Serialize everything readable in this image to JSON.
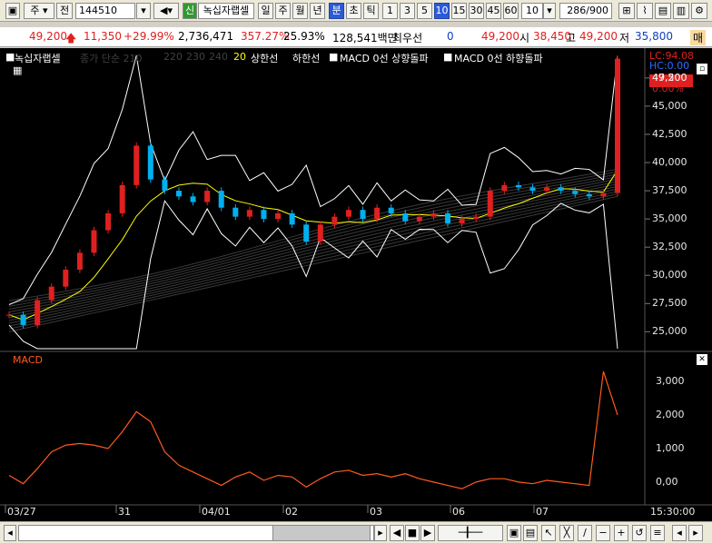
{
  "toolbar": {
    "market": "주",
    "period": "전",
    "code": "144510",
    "name_badge": "신",
    "name": "녹십자랩셀",
    "tf": [
      "일",
      "주",
      "월",
      "년",
      "분",
      "초",
      "틱"
    ],
    "nums": [
      "1",
      "3",
      "5",
      "10",
      "15",
      "30",
      "45",
      "60"
    ],
    "count": "10",
    "range": "286",
    "range_total": "/900"
  },
  "quote": {
    "price": "49,200",
    "change": "11,350",
    "pct": "+29.99%",
    "volume": "2,736,471",
    "vol_ratio": "357.27%",
    "turnover": "25.93%",
    "amount": "128,541백만",
    "label_min": "최우선",
    "zero": "0",
    "price2": "49,200",
    "open_lbl": "시",
    "open": "38,450",
    "high_lbl": "고",
    "high": "49,200",
    "low_lbl": "저",
    "low": "35,800",
    "more": "매"
  },
  "legend": {
    "items": [
      "녹십자랩셀",
      "종가 단순 210",
      "220",
      "230",
      "240",
      "20",
      "상한선",
      "하한선",
      "MACD 0선 상향돌파",
      "MACD 0선 하향돌파"
    ]
  },
  "price_axis": {
    "lc": "LC:94.08",
    "hc": "HC:0.00",
    "current": "49,200",
    "ticks": [
      "47,500",
      "45,000",
      "42,500",
      "40,000",
      "37,500",
      "35,000",
      "32,500",
      "30,000",
      "27,500",
      "25,000"
    ],
    "pct": "0.00%"
  },
  "macd": {
    "title": "MACD",
    "ticks": [
      "3,000",
      "2,000",
      "1,000",
      "0,00"
    ]
  },
  "time_axis": {
    "labels": [
      "03/27",
      "31",
      "04/01",
      "02",
      "03",
      "06",
      "07"
    ],
    "time": "15:30:00"
  },
  "colors": {
    "up": "#e02020",
    "down": "#00b0f0",
    "bg": "#000000",
    "macd": "#ff5a1e",
    "band": "#ffffff",
    "ma": "#ffff00"
  },
  "chart_data": {
    "type": "candlestick",
    "symbol": "녹십자랩셀",
    "series": [
      {
        "name": "녹십자랩셀",
        "values": [
          26500,
          25600,
          27800,
          29000,
          30500,
          32000,
          34000,
          35500,
          38000,
          41500,
          38500,
          37500,
          37000,
          36500,
          37500,
          36000,
          35200,
          35800,
          35000,
          35500,
          34500,
          33000,
          34500,
          35200,
          35800,
          35000,
          36000,
          35500,
          34800,
          35200,
          35500,
          34600,
          35000,
          35200,
          37500,
          38000,
          37800,
          37500,
          37800,
          37500,
          37200,
          37000,
          37300,
          49200
        ]
      }
    ],
    "ylim": [
      23500,
      49500
    ],
    "macd_values": [
      200,
      -50,
      400,
      900,
      1100,
      1150,
      1100,
      1000,
      1500,
      2100,
      1800,
      900,
      500,
      300,
      100,
      -100,
      150,
      300,
      50,
      200,
      150,
      -150,
      100,
      300,
      350,
      200,
      250,
      150,
      250,
      100,
      0,
      -100,
      -200,
      0,
      100,
      100,
      0,
      -50,
      50,
      0,
      -50,
      -100,
      3300,
      2000
    ],
    "macd_ylim": [
      -600,
      3600
    ]
  }
}
